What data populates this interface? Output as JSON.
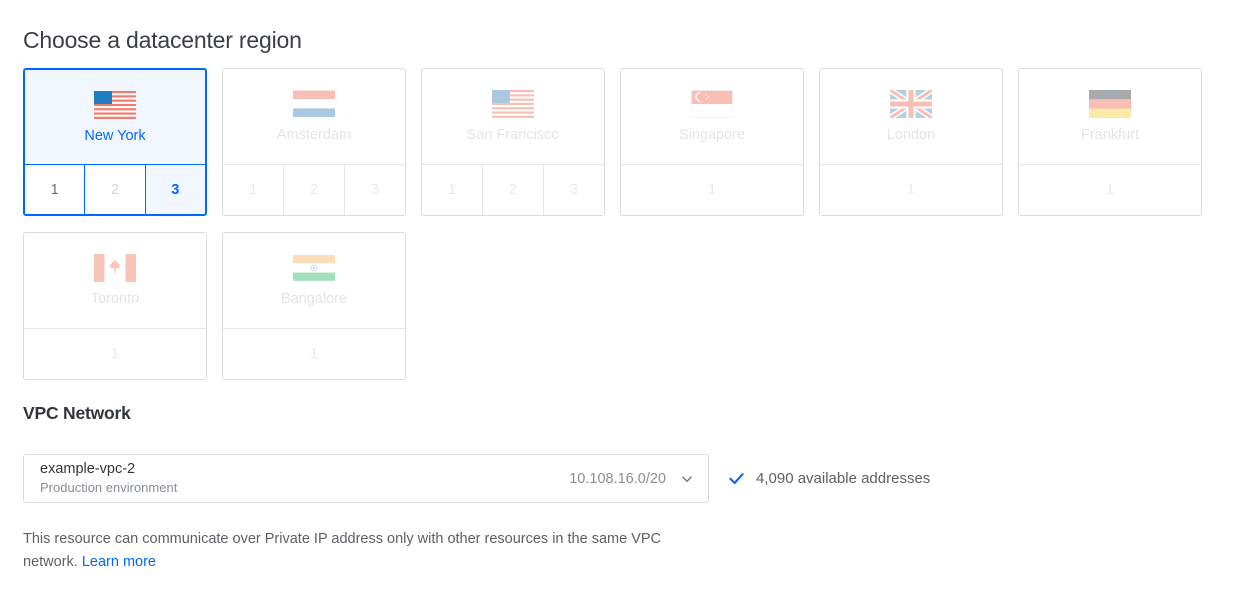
{
  "headings": {
    "region": "Choose a datacenter region",
    "vpc": "VPC Network"
  },
  "regions": [
    {
      "name": "New York",
      "flag": "us-flag-icon",
      "selected": true,
      "tabs": [
        {
          "label": "1",
          "state": "enabled"
        },
        {
          "label": "2",
          "state": "disabled"
        },
        {
          "label": "3",
          "state": "active"
        }
      ]
    },
    {
      "name": "Amsterdam",
      "flag": "netherlands-flag-icon",
      "selected": false,
      "tabs": [
        {
          "label": "1",
          "state": "disabled"
        },
        {
          "label": "2",
          "state": "disabled"
        },
        {
          "label": "3",
          "state": "disabled"
        }
      ]
    },
    {
      "name": "San Francisco",
      "flag": "us-flag-icon",
      "selected": false,
      "tabs": [
        {
          "label": "1",
          "state": "disabled"
        },
        {
          "label": "2",
          "state": "disabled"
        },
        {
          "label": "3",
          "state": "disabled"
        }
      ]
    },
    {
      "name": "Singapore",
      "flag": "singapore-flag-icon",
      "selected": false,
      "tabs": [
        {
          "label": "1",
          "state": "disabled"
        }
      ]
    },
    {
      "name": "London",
      "flag": "united-kingdom-flag-icon",
      "selected": false,
      "tabs": [
        {
          "label": "1",
          "state": "disabled"
        }
      ]
    },
    {
      "name": "Frankfurt",
      "flag": "germany-flag-icon",
      "selected": false,
      "tabs": [
        {
          "label": "1",
          "state": "disabled"
        }
      ]
    },
    {
      "name": "Toronto",
      "flag": "canada-flag-icon",
      "selected": false,
      "tabs": [
        {
          "label": "1",
          "state": "disabled"
        }
      ]
    },
    {
      "name": "Bangalore",
      "flag": "india-flag-icon",
      "selected": false,
      "tabs": [
        {
          "label": "1",
          "state": "disabled"
        }
      ]
    }
  ],
  "vpc": {
    "selected_name": "example-vpc-2",
    "selected_subtitle": "Production environment",
    "selected_cidr": "10.108.16.0/20",
    "chevron_icon": "chevron-down-icon",
    "status_icon": "check-icon",
    "status_text": "4,090 available addresses",
    "help_text_before": "This resource can communicate over Private IP address only with other resources in the same VPC network. ",
    "help_link_label": "Learn more"
  },
  "colors": {
    "accent": "#0069ff",
    "selected_bg": "#f2f7ff",
    "border": "#d9dcde",
    "text": "#31363b",
    "muted": "#868e96",
    "disabled": "#e2e5e8"
  }
}
